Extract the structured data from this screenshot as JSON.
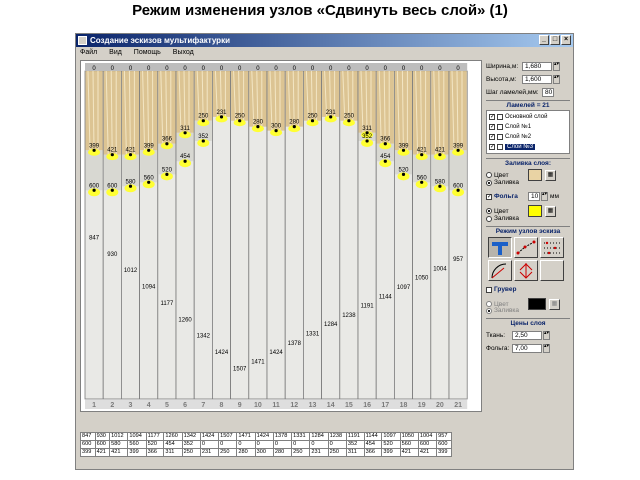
{
  "slide": {
    "title": "Режим изменения узлов «Сдвинуть весь слой» (1)"
  },
  "window": {
    "title": "Создание эскизов мультифактурки",
    "menu": [
      "Файл",
      "Вид",
      "Помощь",
      "Выход"
    ]
  },
  "strips": {
    "count": 21,
    "numbers": [
      "1",
      "2",
      "3",
      "4",
      "5",
      "6",
      "7",
      "8",
      "9",
      "10",
      "11",
      "12",
      "13",
      "14",
      "15",
      "16",
      "17",
      "18",
      "19",
      "20",
      "21"
    ],
    "top_values": [
      "0",
      "0",
      "0",
      "0",
      "0",
      "0",
      "0",
      "0",
      "0",
      "0",
      "0",
      "0",
      "0",
      "0",
      "0",
      "0",
      "0",
      "0",
      "0",
      "0",
      "0"
    ],
    "layer3": [
      399,
      421,
      421,
      399,
      366,
      311,
      250,
      231,
      250,
      280,
      300,
      280,
      250,
      231,
      250,
      311,
      366,
      399,
      421,
      421,
      399
    ],
    "layer2": [
      600,
      600,
      580,
      560,
      520,
      454,
      352,
      0,
      0,
      0,
      0,
      0,
      0,
      0,
      0,
      352,
      454,
      520,
      560,
      580,
      600
    ],
    "layer1": [
      847,
      930,
      1012,
      1094,
      1177,
      1260,
      1342,
      1424,
      1507,
      1471,
      1424,
      1378,
      1331,
      1284,
      1238,
      1191,
      1144,
      1097,
      1050,
      1004,
      957
    ]
  },
  "table_rows": [
    [
      "847",
      "930",
      "1012",
      "1094",
      "1177",
      "1260",
      "1342",
      "1424",
      "1507",
      "1471",
      "1424",
      "1378",
      "1331",
      "1284",
      "1238",
      "1191",
      "1144",
      "1097",
      "1050",
      "1004",
      "957"
    ],
    [
      "600",
      "600",
      "580",
      "560",
      "520",
      "454",
      "352",
      "0",
      "0",
      "0",
      "0",
      "0",
      "0",
      "0",
      "0",
      "352",
      "454",
      "520",
      "560",
      "600",
      "600"
    ],
    [
      "399",
      "421",
      "421",
      "399",
      "366",
      "311",
      "250",
      "231",
      "250",
      "280",
      "300",
      "280",
      "250",
      "231",
      "250",
      "311",
      "366",
      "399",
      "421",
      "421",
      "399"
    ]
  ],
  "panel": {
    "width_label": "Ширина,м:",
    "width_value": "1,680",
    "height_label": "Высота,м:",
    "height_value": "1,600",
    "step_label": "Шаг ламелей,мм:",
    "step_value": "80",
    "lamels_label": "Ламелей = 21",
    "layers": [
      {
        "label": "Основной слой",
        "checked": true,
        "selected": false
      },
      {
        "label": "Слой №1",
        "checked": true,
        "selected": false
      },
      {
        "label": "Слой №2",
        "checked": true,
        "selected": false
      },
      {
        "label": "Слой №3",
        "checked": true,
        "selected": true
      }
    ],
    "fill_head": "Заливка слоя:",
    "fill_color": "Цвет",
    "fill_fill": "Заливка",
    "foil_label": "Фольга",
    "foil_value": "10",
    "foil_unit": "мм",
    "foil_color": "Цвет",
    "foil_fill": "Заливка",
    "mode_head": "Режим узлов эскиза",
    "gruver_label": "Грувер",
    "gruver_color": "Цвет",
    "gruver_fill": "Заливка",
    "prices_head": "Цены слоя",
    "cloth_label": "Ткань:",
    "cloth_value": "2,50",
    "foil_price_label": "Фольга:",
    "foil_price_value": "7,00",
    "colors": {
      "accent": "#0a246a",
      "foil_swatch": "#ffff00",
      "gruver_swatch": "#000000",
      "fill_swatch": "#e9d3a4"
    }
  }
}
